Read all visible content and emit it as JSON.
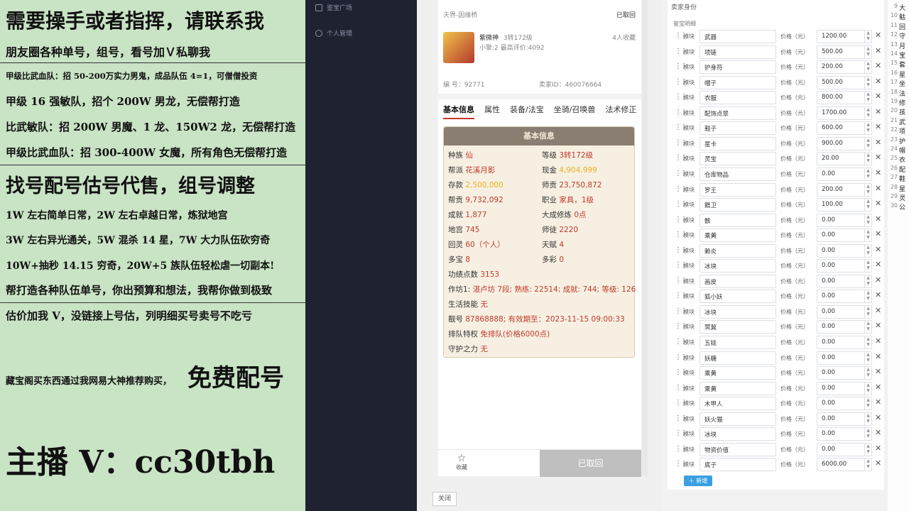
{
  "overlay": {
    "l1": "需要操手或者指挥，请联系我",
    "l2": "朋友圈各种单号，组号，看号加Ｖ私聊我",
    "l3": "甲级比武血队：招 50-200万实力男鬼，成品队伍 4=1，可僧僧投资",
    "l4": "甲级 16 强敏队，招个 200W 男龙，无偿帮打造",
    "l5": "比武敏队：招 200W 男魔、1 龙、150W2 龙，无偿帮打造",
    "l6": "甲级比武血队：招 300-400W 女魔，所有角色无偿帮打造",
    "l7": "找号配号估号代售，组号调整",
    "l8": "1W 左右简单日常，2W 左右卓越日常，炼狱地宫",
    "l9": "3W 左右异光通关，5W 混杀 14 星，7W 大力队伍砍穷奇",
    "l10": "10W+抽秒 14.15 穷奇，20W+5 族队伍轻松虐一切副本!",
    "l11": "帮打造各种队伍单号，你出预算和想法，我帮你做到极致",
    "l12": "估价加我 V，没链接上号估，列明细买号卖号不吃亏",
    "l13a": "藏宝阁买东西通过我网易大神推荐购买，",
    "l13b": "免费配号",
    "l14": "主播 V：cc30tbh"
  },
  "sidebar": {
    "item1": "鉴宝广场",
    "item2": "个人管理"
  },
  "detail": {
    "server": "天界-因缘桥",
    "status": "已取回",
    "name": "紫微神",
    "level_text": "3转172级",
    "sub": "小聚:2 最高评价:4092",
    "fav_count": "4人收藏",
    "id_label": "编 号：",
    "id_value": "92771",
    "seller_label": "卖家ID：",
    "seller_value": "460076664",
    "tabs": [
      "基本信息",
      "属性",
      "装备/法宝",
      "坐骑/召唤兽",
      "法术修正"
    ],
    "card_title": "基本信息",
    "race_k": "种族",
    "race_v": "仙",
    "lvl_k": "等级",
    "lvl_v": "3转172级",
    "gang_k": "帮派",
    "gang_v": "花溪月影",
    "cash_k": "现金",
    "cash_v": "4,904,999",
    "dep_k": "存款",
    "dep_v": "2,500,000",
    "master_k": "师贡",
    "master_v": "23,750,872",
    "contrib_k": "帮贡",
    "contrib_v": "9,732,092",
    "job_k": "职业",
    "job_v": "家具，1级",
    "ach_k": "成就",
    "ach_v": "1,877",
    "dacheng_k": "大成修炼",
    "dacheng_v": "0点",
    "palace_k": "地宫",
    "palace_v": "745",
    "apprentice_k": "师徒",
    "apprentice_v": "2220",
    "soul_k": "回灵",
    "soul_v": "60（个人）",
    "talent_k": "天赋",
    "talent_v": "4",
    "treasure_k": "多宝",
    "treasure_v": "8",
    "color_k": "多彩",
    "color_v": "0",
    "merit_k": "功绩点数",
    "merit_v": "3153",
    "work_k": "作坊1:",
    "work_v": "湛卢坊 7段; 熟练: 22514; 成就: 744; 等级: 126",
    "life_k": "生活技能",
    "life_v": "无",
    "pretty_k": "靓号",
    "pretty_v": "87868888;  有效期至：2023-11-15 09:00:33",
    "queue_k": "排队特权",
    "queue_v": "免排队(价格6000点)",
    "guard_k": "守护之力",
    "guard_v": "无",
    "fav_label": "收藏",
    "cancel_label": "已取回",
    "close_label": "关闭"
  },
  "form": {
    "title": "卖家身份",
    "subtitle": "鉴宝明细",
    "mod_label": "模块",
    "price_label": "价格（元）",
    "add_label": "新增",
    "rows": [
      {
        "name": "武器",
        "price": "1200.00"
      },
      {
        "name": "项链",
        "price": "500.00"
      },
      {
        "name": "护身符",
        "price": "200.00"
      },
      {
        "name": "帽子",
        "price": "500.00"
      },
      {
        "name": "衣服",
        "price": "800.00"
      },
      {
        "name": "配饰点翠",
        "price": "1700.00"
      },
      {
        "name": "鞋子",
        "price": "600.00"
      },
      {
        "name": "星卡",
        "price": "900.00"
      },
      {
        "name": "灵宝",
        "price": "20.00"
      },
      {
        "name": "仓库物品",
        "price": "0.00"
      },
      {
        "name": "罗王",
        "price": "200.00"
      },
      {
        "name": "籍卫",
        "price": "100.00"
      },
      {
        "name": "骸",
        "price": "0.00"
      },
      {
        "name": "乘黄",
        "price": "0.00"
      },
      {
        "name": "赖炎",
        "price": "0.00"
      },
      {
        "name": "冰块",
        "price": "0.00"
      },
      {
        "name": "画皮",
        "price": "0.00"
      },
      {
        "name": "狐小妖",
        "price": "0.00"
      },
      {
        "name": "冰块",
        "price": "0.00"
      },
      {
        "name": "冥冀",
        "price": "0.00"
      },
      {
        "name": "五娃",
        "price": "0.00"
      },
      {
        "name": "妖糖",
        "price": "0.00"
      },
      {
        "name": "乘黄",
        "price": "0.00"
      },
      {
        "name": "乘黄",
        "price": "0.00"
      },
      {
        "name": "木甲人",
        "price": "0.00"
      },
      {
        "name": "妖火猫",
        "price": "0.00"
      },
      {
        "name": "冰块",
        "price": "0.00"
      },
      {
        "name": "物资价值",
        "price": "0.00"
      },
      {
        "name": "底子",
        "price": "6000.00"
      }
    ]
  },
  "edge": {
    "nums": [
      "9",
      "10",
      "11",
      "12",
      "13",
      "14",
      "15",
      "16",
      "17",
      "18",
      "19",
      "20",
      "21",
      "22",
      "23",
      "24",
      "25",
      "26",
      "27",
      "28",
      "29",
      "30"
    ],
    "texts": [
      "大",
      "骷",
      "回",
      "守",
      "月",
      "宝",
      "套",
      "星",
      "坐",
      "法",
      "修",
      "孩",
      "武",
      "项",
      "护",
      "帽",
      "衣",
      "配",
      "鞋",
      "星",
      "灵",
      "公"
    ]
  }
}
